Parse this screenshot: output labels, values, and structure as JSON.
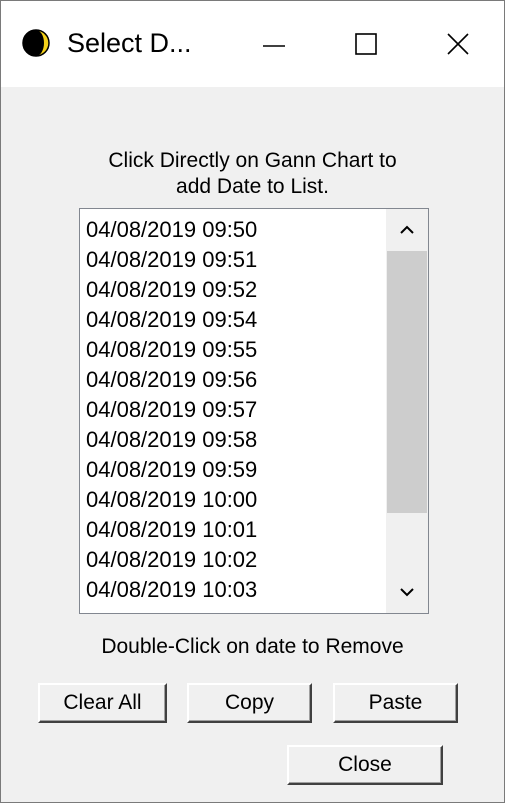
{
  "window": {
    "title": "Select D...",
    "icon": "moon-phase-icon",
    "minimize_glyph": "—",
    "maximize_glyph": "☐",
    "close_glyph": "✕"
  },
  "instructions": {
    "line1": "Click Directly on Gann Chart to",
    "line2": "add Date to List."
  },
  "date_list": {
    "items": [
      "04/08/2019 09:50",
      "04/08/2019 09:51",
      "04/08/2019 09:52",
      "04/08/2019 09:54",
      "04/08/2019 09:55",
      "04/08/2019 09:56",
      "04/08/2019 09:57",
      "04/08/2019 09:58",
      "04/08/2019 09:59",
      "04/08/2019 10:00",
      "04/08/2019 10:01",
      "04/08/2019 10:02",
      "04/08/2019 10:03"
    ]
  },
  "remove_hint": "Double-Click on date to Remove",
  "buttons": {
    "clear_all": "Clear All",
    "copy": "Copy",
    "paste": "Paste",
    "close": "Close"
  }
}
